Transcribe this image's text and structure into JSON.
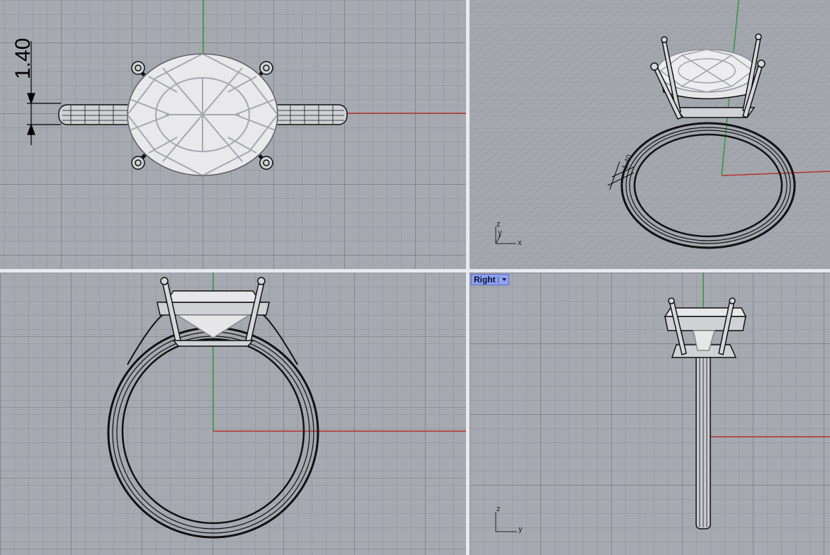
{
  "viewports": {
    "top": {
      "dimension_value": "1.40"
    },
    "perspective": {
      "dimension_value": "1.40",
      "axis_labels": {
        "z": "z",
        "y": "y",
        "x": "x"
      }
    },
    "front": {},
    "right": {
      "title": "Right",
      "menu_icon": "chevron-down-icon",
      "axis_labels": {
        "z": "z",
        "y": "y"
      }
    }
  },
  "colors": {
    "viewport_bg": "#a6a9b0",
    "x_axis": "#b3332f",
    "y_axis": "#2f9a3a",
    "active_label_bg": "#8ea2f0"
  }
}
